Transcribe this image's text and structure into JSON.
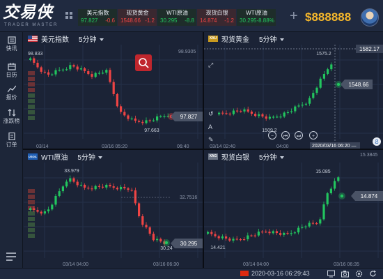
{
  "app": {
    "logo": "交易侠",
    "logo_sub": "TRADER MASTER",
    "balance": "$888888"
  },
  "quotes": [
    {
      "name": "美元指数",
      "price": "97.827",
      "change": "-0.6",
      "dir": "down",
      "active": false
    },
    {
      "name": "现货黄金",
      "price": "1548.66",
      "change": "-1.2",
      "dir": "down",
      "active": true
    },
    {
      "name": "WTI原油",
      "price": "30.295",
      "change": "-8.8",
      "dir": "up",
      "active": false
    },
    {
      "name": "现货白银",
      "price": "14.874",
      "change": "-1.2",
      "dir": "down",
      "active": false
    },
    {
      "name": "WTI原油",
      "price": "30.295",
      "change": "-8.88%",
      "dir": "up",
      "active": false
    }
  ],
  "sidebar": [
    {
      "label": "快讯",
      "icon": "news-icon"
    },
    {
      "label": "日历",
      "icon": "calendar-icon"
    },
    {
      "label": "报价",
      "icon": "quote-icon"
    },
    {
      "label": "涨跌榜",
      "icon": "ranking-icon"
    },
    {
      "label": "订单",
      "icon": "order-icon"
    }
  ],
  "panes": {
    "usd": {
      "title": "美元指数",
      "period": "5分钟",
      "badge": "",
      "max_label": "98.833",
      "min_label": "97.663",
      "right_top": "98.9305",
      "price": "97.827",
      "x_labels": [
        "03/14",
        "03/16 05:20",
        "06:40"
      ],
      "colors": {
        "price_tag": "#4a5366"
      }
    },
    "gold": {
      "title": "现货黄金",
      "period": "5分钟",
      "badge": "XAU",
      "max_label": "1575.2",
      "min_label": "1509.2",
      "right_top": "1582.17",
      "price": "1548.66",
      "x_labels": [
        "03/14 02:40",
        "04:00"
      ],
      "cursor_time": "2020/03/16 06:20 —",
      "colors": {
        "price_tag": "#4a5366"
      }
    },
    "oil": {
      "title": "WTI原油",
      "period": "5分钟",
      "badge": "USOIL",
      "max_label": "33.979",
      "min_label": "30.24",
      "mid_label": "32.7516",
      "price": "30.295",
      "x_labels": [
        "03/14 04:00",
        "03/16 06:30"
      ],
      "colors": {
        "price_tag": "#4a5366"
      }
    },
    "silver": {
      "title": "现货白银",
      "period": "5分钟",
      "badge": "XAG",
      "max_label": "15.085",
      "min_label": "14.421",
      "right_top": "15.3845",
      "price": "14.874",
      "x_labels": [
        "03/14 04:00",
        "03/16 06:35"
      ],
      "colors": {
        "price_tag": "#4a5366"
      }
    }
  },
  "footer": {
    "time": "2020-03-16 06:29:43"
  },
  "colors": {
    "up": "#22c55e",
    "down": "#ef4444",
    "accent": "#f5b72b"
  }
}
